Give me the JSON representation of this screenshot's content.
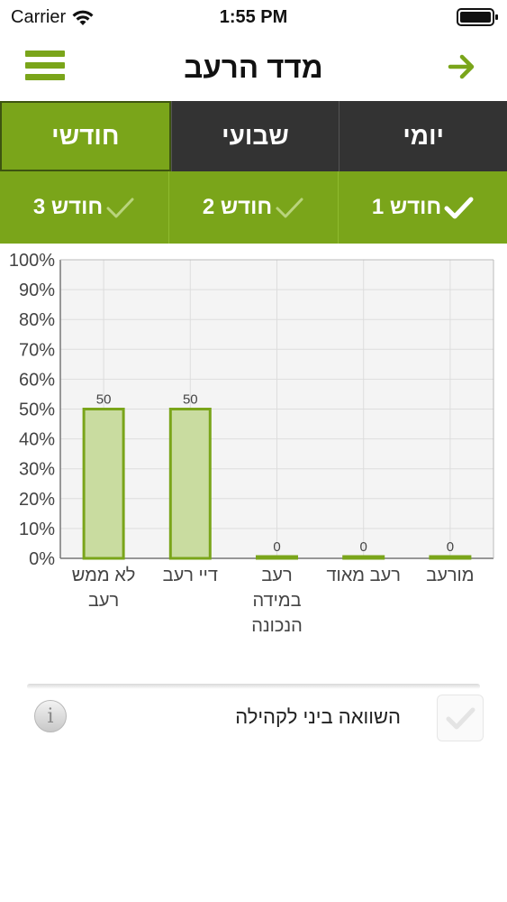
{
  "status_bar": {
    "carrier": "Carrier",
    "time": "1:55 PM"
  },
  "header": {
    "title": "מדד הרעב",
    "menu_icon": "hamburger-menu-icon",
    "forward_icon": "arrow-right-icon"
  },
  "period_tabs": [
    {
      "label": "יומי",
      "active": false
    },
    {
      "label": "שבועי",
      "active": false
    },
    {
      "label": "חודשי",
      "active": true
    }
  ],
  "month_tabs": [
    {
      "label": "חודש 1",
      "checked": true
    },
    {
      "label": "חודש 2",
      "checked": false
    },
    {
      "label": "חודש 3",
      "checked": false
    }
  ],
  "colors": {
    "accent": "#7aa51a",
    "dark_tab": "#333333",
    "bar_fill": "#c9dca0",
    "bar_stroke": "#7aa51a"
  },
  "chart_data": {
    "type": "bar",
    "categories": [
      "לא ממש רעב",
      "דיי רעב",
      "רעב במידה הנכונה",
      "רעב מאוד",
      "מורעב"
    ],
    "category_lines": [
      [
        "לא ממש",
        "רעב"
      ],
      [
        "דיי רעב"
      ],
      [
        "רעב",
        "במידה",
        "הנכונה"
      ],
      [
        "רעב מאוד"
      ],
      [
        "מורעב"
      ]
    ],
    "values": [
      50,
      50,
      0,
      0,
      0
    ],
    "value_labels": [
      "50",
      "50",
      "0",
      "0",
      "0"
    ],
    "ylim": [
      0,
      100
    ],
    "y_ticks": [
      "0%",
      "10%",
      "20%",
      "30%",
      "40%",
      "50%",
      "60%",
      "70%",
      "80%",
      "90%",
      "100%"
    ],
    "grid": true,
    "title": "",
    "xlabel": "",
    "ylabel": ""
  },
  "compare": {
    "label": "השוואה ביני לקהילה",
    "checked": false,
    "info_icon": "info-icon"
  }
}
